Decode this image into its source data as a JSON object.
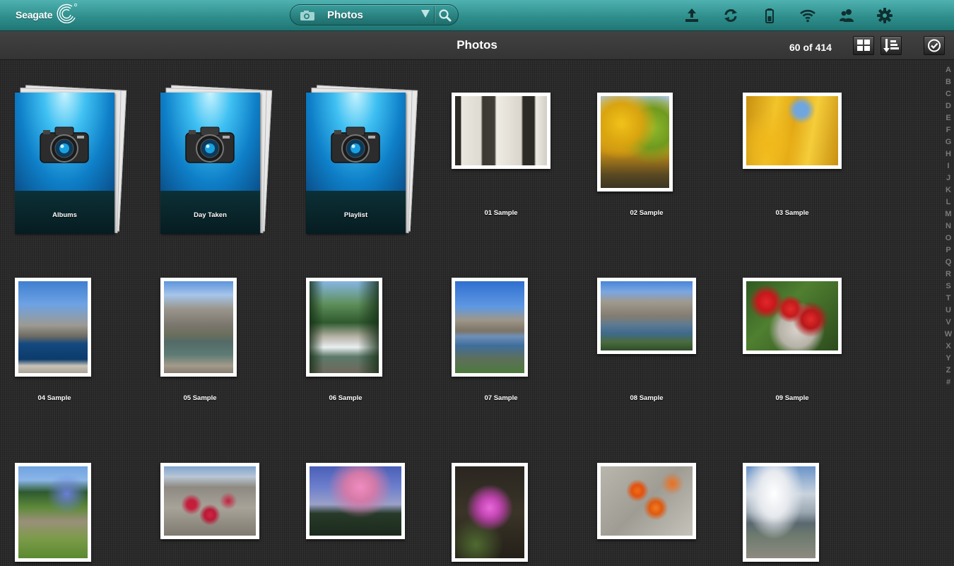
{
  "app": {
    "brand": "Seagate"
  },
  "search": {
    "label": "Photos"
  },
  "toolbar_icons": [
    "upload-icon",
    "sync-icon",
    "battery-icon",
    "wifi-icon",
    "users-icon",
    "gear-icon"
  ],
  "header": {
    "title": "Photos",
    "count": "60 of 414"
  },
  "folders": [
    {
      "label": "Albums"
    },
    {
      "label": "Day Taken"
    },
    {
      "label": "Playlist"
    }
  ],
  "photos": [
    {
      "label": "01 Sample",
      "subject": "aspen trunks"
    },
    {
      "label": "02 Sample",
      "subject": "yellow aspen trees"
    },
    {
      "label": "03 Sample",
      "subject": "golden leaves"
    },
    {
      "label": "04 Sample",
      "subject": "mountain lake"
    },
    {
      "label": "05 Sample",
      "subject": "granite peak lake"
    },
    {
      "label": "06 Sample",
      "subject": "forest creek"
    },
    {
      "label": "07 Sample",
      "subject": "alpine reflection"
    },
    {
      "label": "08 Sample",
      "subject": "high lake"
    },
    {
      "label": "09 Sample",
      "subject": "red paintbrush flower"
    },
    {
      "label": "",
      "subject": "lupine meadow"
    },
    {
      "label": "",
      "subject": "red flowers on rock"
    },
    {
      "label": "",
      "subject": "pink sunset clouds"
    },
    {
      "label": "",
      "subject": "thistle flower"
    },
    {
      "label": "",
      "subject": "orange lilies"
    },
    {
      "label": "",
      "subject": "cloudy valley"
    }
  ],
  "alphabet": [
    "A",
    "B",
    "C",
    "D",
    "E",
    "F",
    "G",
    "H",
    "I",
    "J",
    "K",
    "L",
    "M",
    "N",
    "O",
    "P",
    "Q",
    "R",
    "S",
    "T",
    "U",
    "V",
    "W",
    "X",
    "Y",
    "Z",
    "#"
  ]
}
